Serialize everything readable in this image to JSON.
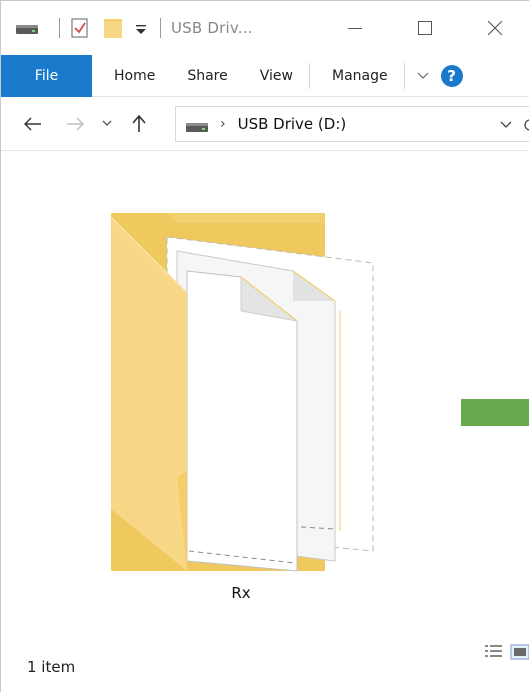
{
  "titlebar": {
    "title": "USB Driv...",
    "icons": [
      "drive-icon",
      "properties-icon",
      "new-folder-icon",
      "customize-dropdown-icon"
    ],
    "controls": [
      "minimize",
      "maximize",
      "close"
    ]
  },
  "ribbon": {
    "tabs": [
      {
        "label": "File",
        "active": true
      },
      {
        "label": "Home"
      },
      {
        "label": "Share"
      },
      {
        "label": "View"
      },
      {
        "label": "Manage"
      }
    ],
    "accent": "#1979ca"
  },
  "address": {
    "path_label": "USB Drive (D:)",
    "separator": "›"
  },
  "content": {
    "items": [
      {
        "name": "Rx",
        "type": "folder"
      }
    ]
  },
  "status": {
    "count_text": "1 item"
  },
  "colors": {
    "folder_back": "#f2cf6f",
    "folder_front": "#f8d886",
    "green_accent": "#6aa84f"
  }
}
